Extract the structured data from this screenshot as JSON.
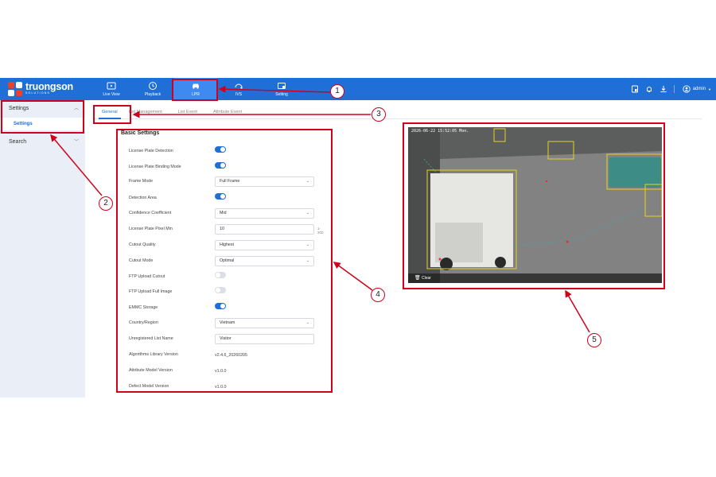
{
  "brand": {
    "name": "truongson",
    "tagline": "SOLUTIONS"
  },
  "nav": [
    {
      "label": "Live View",
      "icon": "live-view-icon"
    },
    {
      "label": "Playback",
      "icon": "playback-icon"
    },
    {
      "label": "LPR",
      "icon": "car-icon",
      "active": true
    },
    {
      "label": "IVS",
      "icon": "ivs-icon"
    },
    {
      "label": "Setting",
      "icon": "setting-icon"
    }
  ],
  "topright": {
    "user": "admin"
  },
  "sidebar": {
    "groups": [
      {
        "label": "Settings",
        "expanded": true,
        "items": [
          {
            "label": "Settings",
            "active": true
          }
        ]
      },
      {
        "label": "Search",
        "expanded": false,
        "items": []
      }
    ]
  },
  "tabs": [
    {
      "label": "General",
      "active": true
    },
    {
      "label": "List Management"
    },
    {
      "label": "List Event"
    },
    {
      "label": "Attribute Event"
    }
  ],
  "panel": {
    "title": "Basic Settings",
    "rows": [
      {
        "label": "License Plate Detection",
        "type": "toggle",
        "on": true
      },
      {
        "label": "License Plate Binding Mode",
        "type": "toggle",
        "on": true
      },
      {
        "label": "Frame Mode",
        "type": "select",
        "value": "Full Frame"
      },
      {
        "label": "Detection Area",
        "type": "toggle",
        "on": true
      },
      {
        "label": "Confidence Coefficient",
        "type": "select",
        "value": "Mid"
      },
      {
        "label": "License Plate Pixel Min",
        "type": "input",
        "value": "10",
        "hint": "1-300"
      },
      {
        "label": "Cutout Quality",
        "type": "select",
        "value": "Highest"
      },
      {
        "label": "Cutout Mode",
        "type": "select",
        "value": "Optimal"
      },
      {
        "label": "FTP Upload Cutout",
        "type": "toggle",
        "on": false
      },
      {
        "label": "FTP Upload Full Image",
        "type": "toggle",
        "on": false
      },
      {
        "label": "EMMC Storage",
        "type": "toggle",
        "on": true
      },
      {
        "label": "Country/Region",
        "type": "select",
        "value": "Vietnam"
      },
      {
        "label": "Unregistered List Name",
        "type": "input",
        "value": "Visitor"
      },
      {
        "label": "Algorithms Library Version",
        "type": "text",
        "value": "v2.4.6_20260205"
      },
      {
        "label": "Attribute Model Version",
        "type": "text",
        "value": "v1.0.0"
      },
      {
        "label": "Defect Model Version",
        "type": "text",
        "value": "v1.0.0"
      }
    ]
  },
  "video": {
    "timestamp": "2026-06-22 15:52:05 Mon.",
    "clear_label": "Clear"
  },
  "callouts": [
    "1",
    "2",
    "3",
    "4",
    "5"
  ],
  "colors": {
    "topbar": "#1f6fd6",
    "accent": "#1f6fd6",
    "annotation": "#d0021b"
  }
}
